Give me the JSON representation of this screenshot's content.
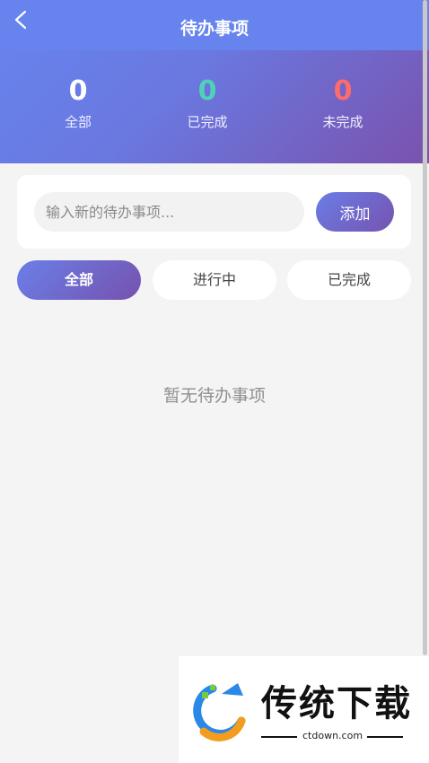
{
  "header": {
    "title": "待办事项",
    "back_icon": "chevron-left-icon"
  },
  "stats": {
    "all": {
      "value": "0",
      "label": "全部",
      "color": "#ffffff"
    },
    "done": {
      "value": "0",
      "label": "已完成",
      "color": "#4fd1b8"
    },
    "todo": {
      "value": "0",
      "label": "未完成",
      "color": "#ff6b6b"
    }
  },
  "input": {
    "placeholder": "输入新的待办事项...",
    "value": "",
    "add_label": "添加"
  },
  "tabs": [
    {
      "label": "全部",
      "active": true
    },
    {
      "label": "进行中",
      "active": false
    },
    {
      "label": "已完成",
      "active": false
    }
  ],
  "empty_text": "暂无待办事项",
  "watermark": {
    "brand": "传统下载",
    "url": "ctdown.com"
  },
  "colors": {
    "header_top": "#6784ee",
    "accent_start": "#6a7de6",
    "accent_end": "#7653b0",
    "background": "#f4f4f4"
  }
}
